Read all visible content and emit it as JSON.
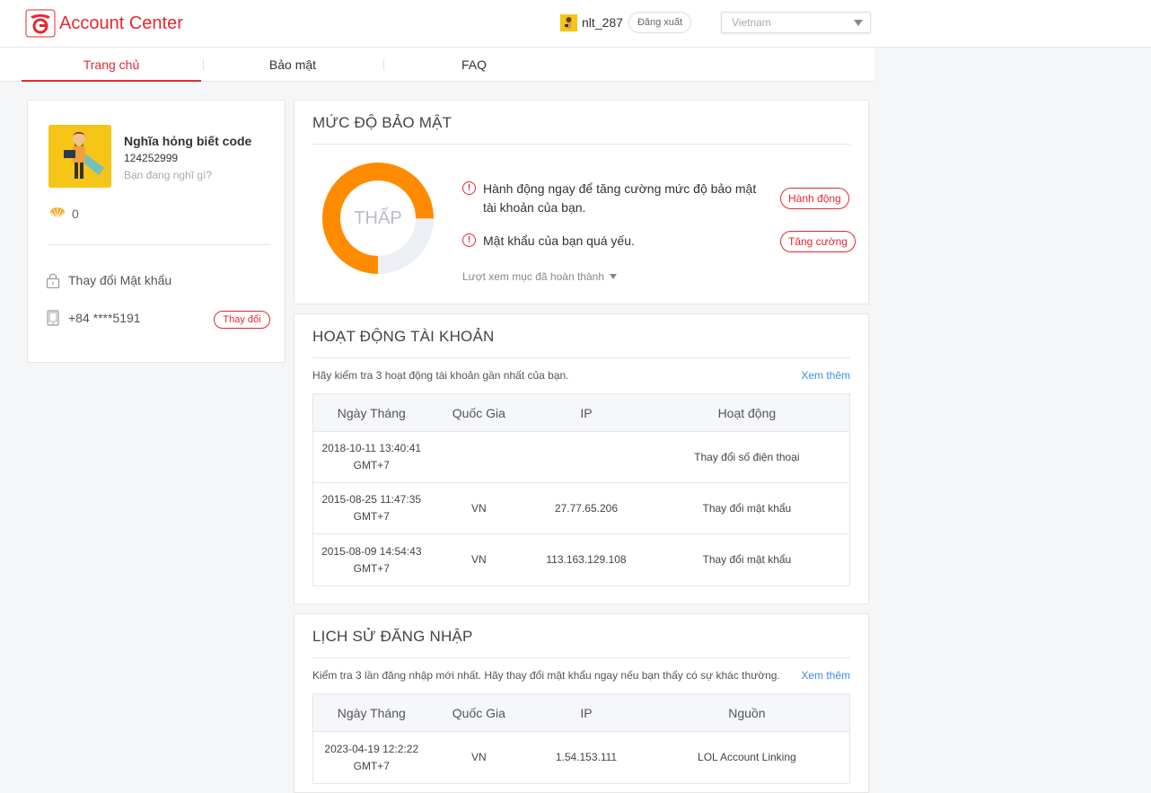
{
  "header": {
    "app_title": "Account Center",
    "username": "nlt_287",
    "logout_label": "Đăng xuất",
    "region_value": "Vietnam"
  },
  "nav": {
    "tabs": [
      {
        "label": "Trang chủ",
        "active": true
      },
      {
        "label": "Bảo mật",
        "active": false
      },
      {
        "label": "FAQ",
        "active": false
      }
    ]
  },
  "profile": {
    "display_name": "Nghĩa hỏng biết code",
    "uid": "124252999",
    "status_placeholder": "Bạn đang nghĩ gì?",
    "shells": "0",
    "change_password_label": "Thay đổi Mật khẩu",
    "phone": "+84 ****5191",
    "change_phone_label": "Thay đổi"
  },
  "security": {
    "title": "MỨC ĐỘ BẢO MẬT",
    "level_label": "THẤP",
    "level_fraction": 0.75,
    "colors": {
      "accent": "#ff8c00",
      "track": "#eceff3",
      "alert": "#e8262f"
    },
    "alerts": [
      {
        "text_line1": "Hành động ngay để tăng cường mức độ bảo mật",
        "text_line2": "tài khoản của bạn.",
        "button": "Hành động"
      },
      {
        "text_line1": "Mật khẩu của bạn quá yếu.",
        "text_line2": "",
        "button": "Tăng cường"
      }
    ],
    "view_completed": "Lượt xem mục đã hoàn thành"
  },
  "activity": {
    "title": "HOẠT ĐỘNG TÀI KHOẢN",
    "subtitle": "Hãy kiểm tra 3 hoạt động tài khoản gần nhất của bạn.",
    "see_more": "Xem thêm",
    "columns": [
      "Ngày Tháng",
      "Quốc Gia",
      "IP",
      "Hoạt động"
    ],
    "rows": [
      {
        "date": "2018-10-11 13:40:41",
        "tz": "GMT+7",
        "country": "",
        "ip": "",
        "action": "Thay đổi số điện thoại"
      },
      {
        "date": "2015-08-25 11:47:35",
        "tz": "GMT+7",
        "country": "VN",
        "ip": "27.77.65.206",
        "action": "Thay đổi mật khẩu"
      },
      {
        "date": "2015-08-09 14:54:43",
        "tz": "GMT+7",
        "country": "VN",
        "ip": "113.163.129.108",
        "action": "Thay đổi mật khẩu"
      }
    ]
  },
  "login_history": {
    "title": "LỊCH SỬ ĐĂNG NHẬP",
    "subtitle": "Kiểm tra 3 lần đăng nhập mới nhất. Hãy thay đổi mật khẩu ngay nếu bạn thấy có sự khác thường.",
    "see_more": "Xem thêm",
    "columns": [
      "Ngày Tháng",
      "Quốc Gia",
      "IP",
      "Nguồn"
    ],
    "rows": [
      {
        "date": "2023-04-19 12:2:22",
        "tz": "GMT+7",
        "country": "VN",
        "ip": "1.54.153.111",
        "source": "LOL Account Linking"
      }
    ]
  }
}
